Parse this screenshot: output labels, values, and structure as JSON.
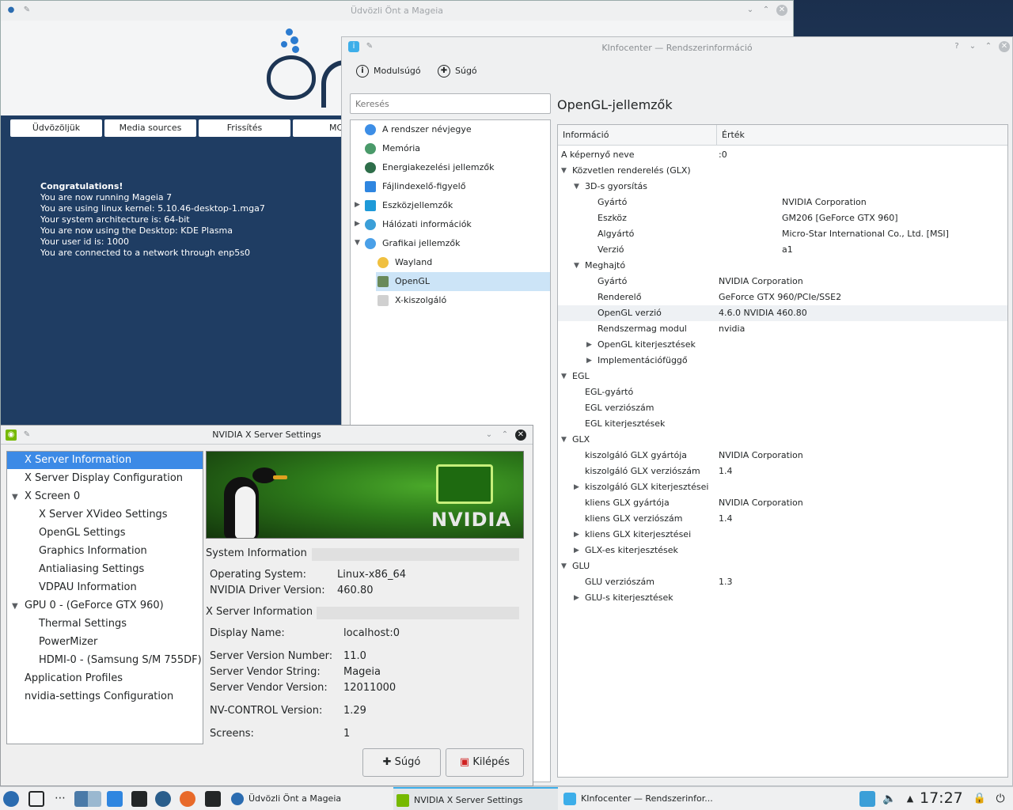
{
  "mageia": {
    "title": "Üdvözli Önt a Mageia",
    "tabs": [
      "Üdvözöljük",
      "Media sources",
      "Frissítés",
      "MC"
    ],
    "lines": {
      "l0": "Congratulations!",
      "l1": "You are now running Mageia 7",
      "l2": "You are using linux kernel: 5.10.46-desktop-1.mga7",
      "l3": "Your system architecture is: 64-bit",
      "l4": "You are now using the Desktop: KDE Plasma",
      "l5": "Your user id is: 1000",
      "l6": "You are connected to a network through enp5s0"
    }
  },
  "kinfo": {
    "title": "KInfocenter — Rendszerinformáció",
    "toolbar": {
      "module_help": "Modulsúgó",
      "help": "Súgó"
    },
    "search_placeholder": "Keresés",
    "page_title": "OpenGL-jellemzők",
    "columns": {
      "info": "Információ",
      "value": "Érték"
    },
    "tree": [
      "A rendszer névjegye",
      "Memória",
      "Energiakezelési jellemzők",
      "Fájlindexelő-figyelő",
      "Eszközjellemzők",
      "Hálózati információk",
      "Grafikai jellemzők",
      "Wayland",
      "OpenGL",
      "X-kiszolgáló"
    ],
    "rows": [
      {
        "k": "A képernyő neve",
        "v": ":0"
      },
      {
        "k": "Közvetlen renderelés (GLX)",
        "v": ""
      },
      {
        "k": "3D-s gyorsítás",
        "v": ""
      },
      {
        "k": "Gyártó",
        "v": "NVIDIA Corporation"
      },
      {
        "k": "Eszköz",
        "v": "GM206 [GeForce GTX 960]"
      },
      {
        "k": "Algyártó",
        "v": "Micro-Star International Co., Ltd. [MSI]"
      },
      {
        "k": "Verzió",
        "v": "a1"
      },
      {
        "k": "Meghajtó",
        "v": ""
      },
      {
        "k": "Gyártó",
        "v": "NVIDIA Corporation"
      },
      {
        "k": "Renderelő",
        "v": "GeForce GTX 960/PCIe/SSE2"
      },
      {
        "k": "OpenGL verzió",
        "v": "4.6.0 NVIDIA 460.80"
      },
      {
        "k": "Rendszermag modul",
        "v": "nvidia"
      },
      {
        "k": "OpenGL kiterjesztések",
        "v": ""
      },
      {
        "k": "Implementációfüggő",
        "v": ""
      },
      {
        "k": "EGL",
        "v": ""
      },
      {
        "k": "EGL-gyártó",
        "v": ""
      },
      {
        "k": "EGL verziószám",
        "v": ""
      },
      {
        "k": "EGL kiterjesztések",
        "v": ""
      },
      {
        "k": "GLX",
        "v": ""
      },
      {
        "k": "kiszolgáló GLX gyártója",
        "v": "NVIDIA Corporation"
      },
      {
        "k": "kiszolgáló GLX verziószám",
        "v": "1.4"
      },
      {
        "k": "kiszolgáló GLX kiterjesztései",
        "v": ""
      },
      {
        "k": "kliens GLX gyártója",
        "v": "NVIDIA Corporation"
      },
      {
        "k": "kliens GLX verziószám",
        "v": "1.4"
      },
      {
        "k": "kliens GLX kiterjesztései",
        "v": ""
      },
      {
        "k": "GLX-es kiterjesztések",
        "v": ""
      },
      {
        "k": "GLU",
        "v": ""
      },
      {
        "k": "GLU verziószám",
        "v": "1.3"
      },
      {
        "k": "GLU-s kiterjesztések",
        "v": ""
      }
    ]
  },
  "nvidia": {
    "title": "NVIDIA X Server Settings",
    "tree": [
      "X Server Information",
      "X Server Display Configuration",
      "X Screen 0",
      "X Server XVideo Settings",
      "OpenGL Settings",
      "Graphics Information",
      "Antialiasing Settings",
      "VDPAU Information",
      "GPU 0 - (GeForce GTX 960)",
      "Thermal Settings",
      "PowerMizer",
      "HDMI-0 - (Samsung S/M 755DF)",
      "Application Profiles",
      "nvidia-settings Configuration"
    ],
    "logo_text": "NVIDIA",
    "system_section": "System Information",
    "os_label": "Operating System:",
    "os_value": "Linux-x86_64",
    "driver_label": "NVIDIA Driver Version:",
    "driver_value": "460.80",
    "xserver_section": "X Server Information",
    "display_label": "Display Name:",
    "display_value": "localhost:0",
    "svn_label": "Server Version Number:",
    "svn_value": "11.0",
    "svs_label": "Server Vendor String:",
    "svs_value": "Mageia",
    "svv_label": "Server Vendor Version:",
    "svv_value": "12011000",
    "nvc_label": "NV-CONTROL Version:",
    "nvc_value": "1.29",
    "screens_label": "Screens:",
    "screens_value": "1",
    "help_button": "Súgó",
    "quit_button": "Kilépés"
  },
  "taskbar": {
    "tasks": [
      "Üdvözli Önt a Mageia",
      "NVIDIA X Server Settings",
      "KInfocenter — Rendszerinfor..."
    ],
    "clock": "17:27"
  }
}
